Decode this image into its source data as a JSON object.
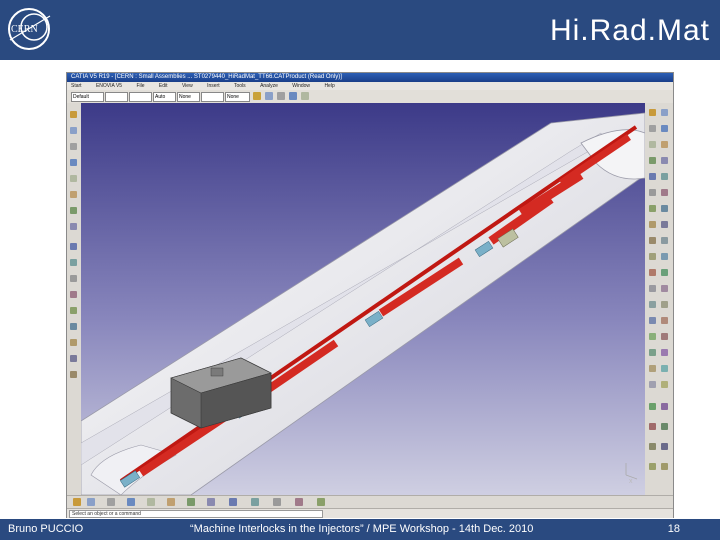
{
  "slide": {
    "title": "Hi.Rad.Mat",
    "logo_text": "CERN",
    "footer_author": "Bruno PUCCIO",
    "footer_center": "“Machine Interlocks in the Injectors” / MPE Workshop - 14th Dec. 2010",
    "page_number": "18"
  },
  "app": {
    "window_title": "CATIA V5 R19 - [CERN : Small Assemblies ... ST0279440_HiRadMat_TT66.CATProduct (Read Only)]",
    "menu": [
      "Start",
      "ENOVIA V5",
      "File",
      "Edit",
      "View",
      "Insert",
      "Tools",
      "Analyze",
      "Window",
      "Help"
    ],
    "toolbar_selects": [
      "Default",
      "",
      "",
      "Auto",
      "None",
      "",
      "None"
    ],
    "status_text": "Select an object or a command",
    "compass_label": "x",
    "colors": {
      "viewport_top": "#3a3a8a",
      "viewport_bottom": "#c6c6dc",
      "beam_pipe": "#c8201a",
      "tunnel": "#f2f2f2",
      "target_block": "#6a6a6a"
    }
  }
}
